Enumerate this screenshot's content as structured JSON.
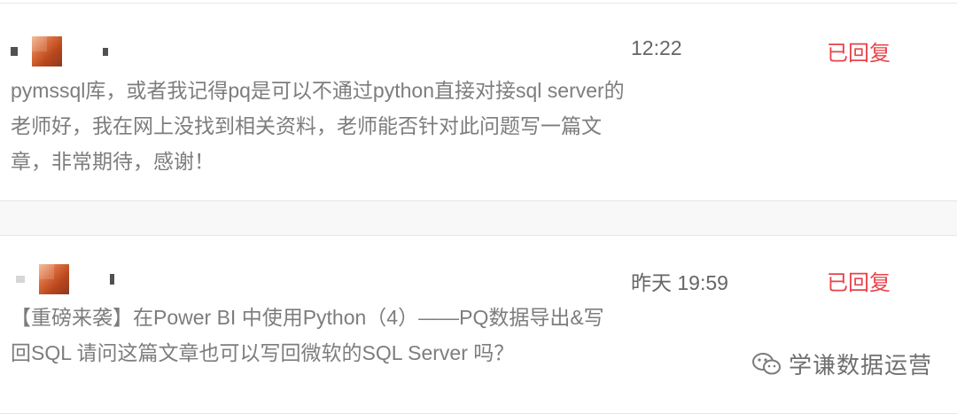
{
  "comments": [
    {
      "time": "12:22",
      "status": "已回复",
      "text": "pymssql库，或者我记得pq是可以不通过python直接对接sql server的 老师好，我在网上没找到相关资料，老师能否针对此问题写一篇文章，非常期待，感谢！"
    },
    {
      "time": "昨天 19:59",
      "status": "已回复",
      "text": "【重磅来袭】在Power BI 中使用Python（4）——PQ数据导出&写回SQL 请问这篇文章也可以写回微软的SQL Server 吗？"
    }
  ],
  "watermark": {
    "text": "学谦数据运营",
    "icon": "wechat-icon"
  },
  "colors": {
    "status": "#e8434a",
    "text": "#7d7d7d",
    "divider": "#e6e6e6"
  }
}
